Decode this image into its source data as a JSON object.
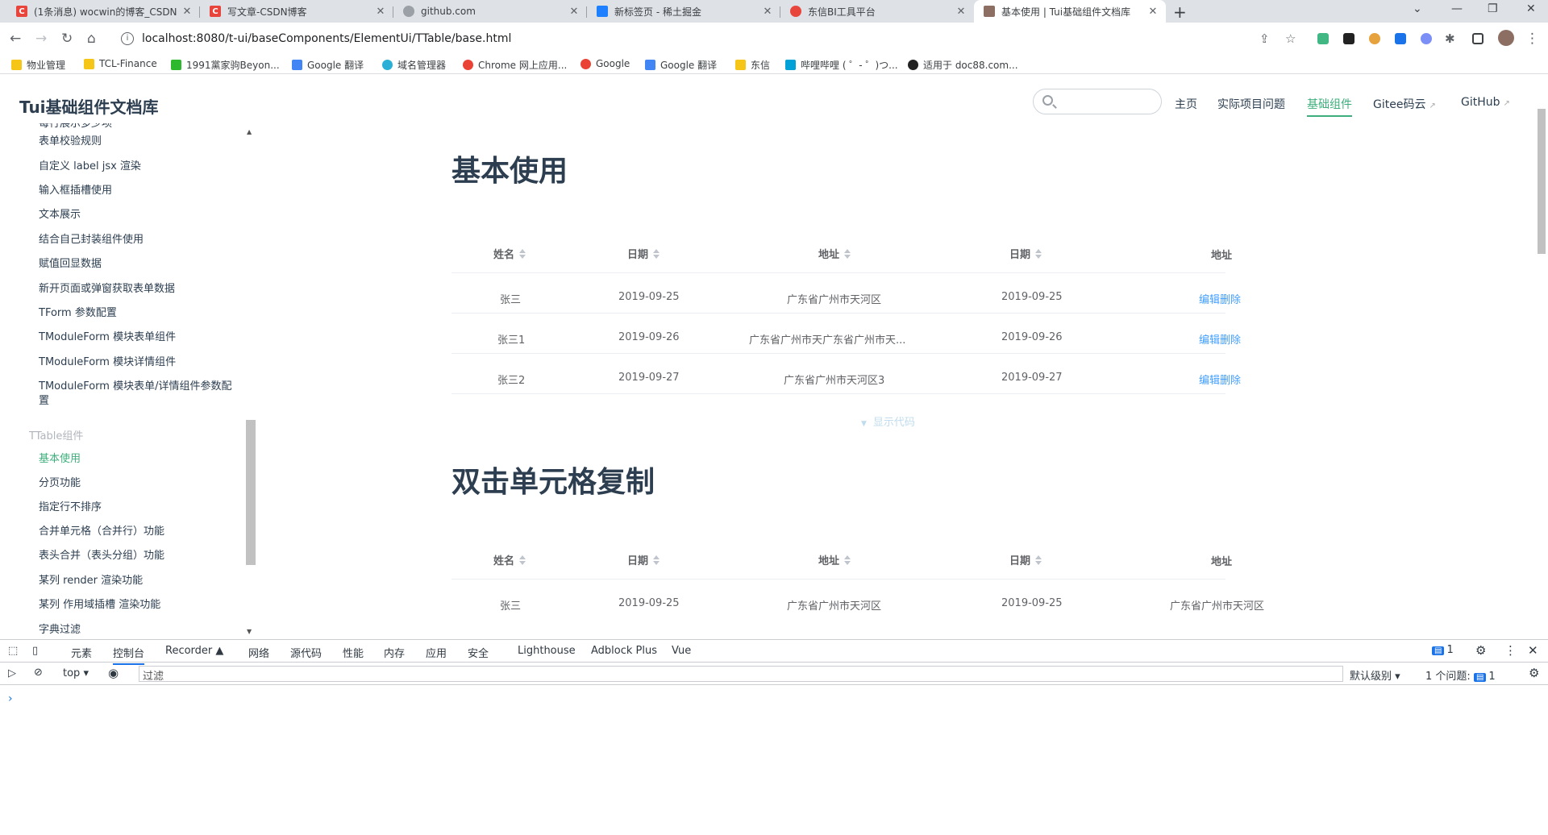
{
  "tabs": [
    {
      "title": "(1条消息) wocwin的博客_CSDN",
      "color": "#e8453c",
      "glyph": "C"
    },
    {
      "title": "写文章-CSDN博客",
      "color": "#e8453c",
      "glyph": "C"
    },
    {
      "title": "github.com",
      "color": "#9aa0a6",
      "glyph": ""
    },
    {
      "title": "新标签页 - 稀土掘金",
      "color": "#1e80ff",
      "glyph": ""
    },
    {
      "title": "东信BI工具平台",
      "color": "#e8453c",
      "glyph": ""
    },
    {
      "title": "基本使用 | Tui基础组件文档库",
      "color": "#8d6e63",
      "glyph": ""
    }
  ],
  "url": "localhost:8080/t-ui/baseComponents/ElementUi/TTable/base.html",
  "bookmarks": [
    {
      "label": "物业管理",
      "color": "#f5c518"
    },
    {
      "label": "TCL-Finance",
      "color": "#f5c518"
    },
    {
      "label": "1991黨家驹Beyon...",
      "color": "#2eb82e"
    },
    {
      "label": "Google 翻译",
      "color": "#4285f4"
    },
    {
      "label": "域名管理器",
      "color": "#2ab0d6"
    },
    {
      "label": "Chrome 网上应用...",
      "color": "#ea4335"
    },
    {
      "label": "Google",
      "color": "#ea4335"
    },
    {
      "label": "Google 翻译",
      "color": "#4285f4"
    },
    {
      "label": "东信",
      "color": "#f5c518"
    },
    {
      "label": "哔哩哔哩 ( ゜- ゜)つ...",
      "color": "#00a1d6"
    },
    {
      "label": "适用于 doc88.com...",
      "color": "#222222"
    }
  ],
  "site": {
    "title": "Tui基础组件文档库",
    "nav": [
      "主页",
      "实际项目问题",
      "基础组件",
      "Gitee码云",
      "GitHub"
    ],
    "active_nav": "基础组件"
  },
  "sidebar": {
    "items_top": [
      "每行展示多少项",
      "表单校验规则",
      "自定义 label jsx 渲染",
      "输入框插槽使用",
      "文本展示",
      "结合自己封装组件使用",
      "赋值回显数据",
      "新开页面或弹窗获取表单数据",
      "TForm 参数配置",
      "TModuleForm 模块表单组件",
      "TModuleForm 模块详情组件",
      "TModuleForm 模块表单/详情组件参数配置"
    ],
    "group": "TTable组件",
    "items_bottom": [
      "基本使用",
      "分页功能",
      "指定行不排序",
      "合并单元格（合并行）功能",
      "表头合并（表头分组）功能",
      "某列 render 渲染功能",
      "某列 作用域插槽 渲染功能",
      "字典过滤"
    ],
    "active": "基本使用"
  },
  "section1": {
    "title": "基本使用",
    "headers": [
      "姓名",
      "日期",
      "地址",
      "日期",
      "地址"
    ],
    "rows": [
      [
        "张三",
        "2019-09-25",
        "广东省广州市天河区",
        "2019-09-25",
        "编辑删除"
      ],
      [
        "张三1",
        "2019-09-26",
        "广东省广州市天广东省广州市天...",
        "2019-09-26",
        "编辑删除"
      ],
      [
        "张三2",
        "2019-09-27",
        "广东省广州市天河区3",
        "2019-09-27",
        "编辑删除"
      ]
    ],
    "show_code": "显示代码"
  },
  "section2": {
    "title": "双击单元格复制",
    "headers": [
      "姓名",
      "日期",
      "地址",
      "日期",
      "地址"
    ],
    "rows": [
      [
        "张三",
        "2019-09-25",
        "广东省广州市天河区",
        "2019-09-25",
        "广东省广州市天河区"
      ]
    ]
  },
  "devtools": {
    "tabs": [
      "元素",
      "控制台",
      "Recorder",
      "网络",
      "源代码",
      "性能",
      "内存",
      "应用",
      "安全",
      "Lighthouse",
      "Adblock Plus",
      "Vue"
    ],
    "active_tab": "控制台",
    "context": "top",
    "filter_placeholder": "过滤",
    "level": "默认级别",
    "issues_label": "1 个问题:",
    "issues_count": "1",
    "msg_count": "1"
  }
}
